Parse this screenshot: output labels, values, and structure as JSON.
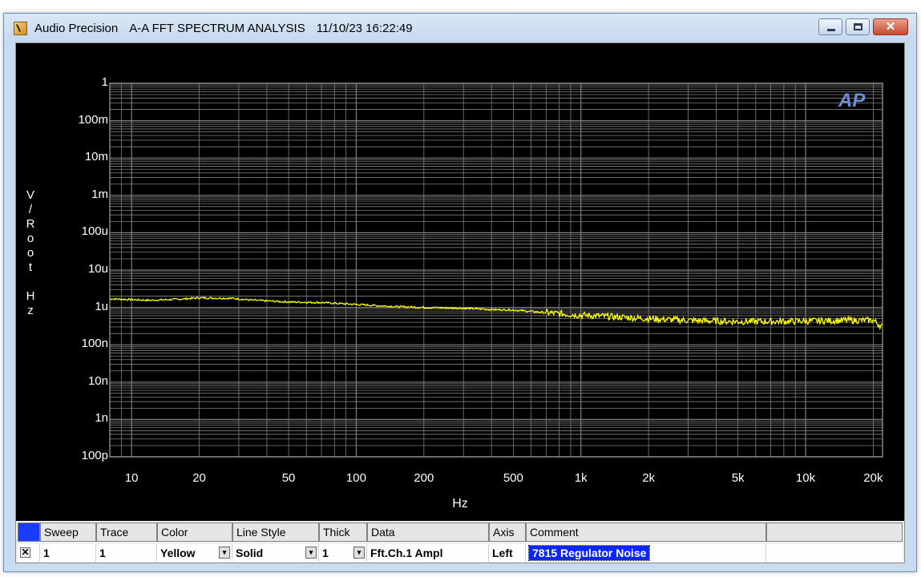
{
  "window": {
    "app_name": "Audio Precision",
    "doc_title": "A-A FFT SPECTRUM ANALYSIS",
    "timestamp": "11/10/23 16:22:49",
    "close_glyph": "✕"
  },
  "graph": {
    "logo": "AP",
    "ylabel": "V\n/\nR\no\no\nt\n\nH\nz",
    "xlabel": "Hz"
  },
  "colors": {
    "background": "#000000",
    "grid": "#7f7f7f",
    "trace": "#ffff00",
    "selection": "#0a25ff"
  },
  "chart_data": {
    "type": "line",
    "xlabel": "Hz",
    "ylabel": "V/Root Hz",
    "x_scale": "log",
    "y_scale": "log",
    "xlim": [
      8,
      22000
    ],
    "ylim": [
      1e-10,
      1
    ],
    "grid": true,
    "y_ticks": [
      {
        "value": 1,
        "label": "1"
      },
      {
        "value": 0.1,
        "label": "100m"
      },
      {
        "value": 0.01,
        "label": "10m"
      },
      {
        "value": 0.001,
        "label": "1m"
      },
      {
        "value": 0.0001,
        "label": "100u"
      },
      {
        "value": 1e-05,
        "label": "10u"
      },
      {
        "value": 1e-06,
        "label": "1u"
      },
      {
        "value": 1e-07,
        "label": "100n"
      },
      {
        "value": 1e-08,
        "label": "10n"
      },
      {
        "value": 1e-09,
        "label": "1n"
      },
      {
        "value": 1e-10,
        "label": "100p"
      }
    ],
    "x_ticks": [
      {
        "value": 10,
        "label": "10"
      },
      {
        "value": 20,
        "label": "20"
      },
      {
        "value": 50,
        "label": "50"
      },
      {
        "value": 100,
        "label": "100"
      },
      {
        "value": 200,
        "label": "200"
      },
      {
        "value": 500,
        "label": "500"
      },
      {
        "value": 1000,
        "label": "1k"
      },
      {
        "value": 2000,
        "label": "2k"
      },
      {
        "value": 5000,
        "label": "5k"
      },
      {
        "value": 10000,
        "label": "10k"
      },
      {
        "value": 20000,
        "label": "20k"
      }
    ],
    "series": [
      {
        "name": "Fft.Ch.1 Ampl",
        "color": "#ffff00",
        "points": [
          [
            8,
            1.7e-06
          ],
          [
            12,
            1.55e-06
          ],
          [
            16,
            1.65e-06
          ],
          [
            20,
            1.8e-06
          ],
          [
            28,
            1.75e-06
          ],
          [
            35,
            1.55e-06
          ],
          [
            50,
            1.4e-06
          ],
          [
            70,
            1.35e-06
          ],
          [
            100,
            1.2e-06
          ],
          [
            150,
            1.05e-06
          ],
          [
            200,
            1e-06
          ],
          [
            300,
            9.5e-07
          ],
          [
            400,
            8.8e-07
          ],
          [
            500,
            8.5e-07
          ],
          [
            700,
            7.2e-07
          ],
          [
            1000,
            6.2e-07
          ],
          [
            1500,
            5.5e-07
          ],
          [
            2000,
            5e-07
          ],
          [
            3000,
            4.5e-07
          ],
          [
            4000,
            4.3e-07
          ],
          [
            5000,
            4.2e-07
          ],
          [
            7000,
            4.2e-07
          ],
          [
            10000,
            4.3e-07
          ],
          [
            15000,
            4.5e-07
          ],
          [
            20000,
            4.5e-07
          ],
          [
            22000,
            3e-07
          ]
        ]
      }
    ]
  },
  "table": {
    "headers": [
      "",
      "Sweep",
      "Trace",
      "Color",
      "Line Style",
      "Thick",
      "Data",
      "Axis",
      "Comment",
      ""
    ],
    "row": {
      "check": "✕",
      "sweep": "1",
      "trace": "1",
      "color": "Yellow",
      "line_style": "Solid",
      "thick": "1",
      "data": "Fft.Ch.1 Ampl",
      "axis": "Left",
      "comment": "7815 Regulator Noise",
      "dropdown_glyph": "▾"
    }
  }
}
